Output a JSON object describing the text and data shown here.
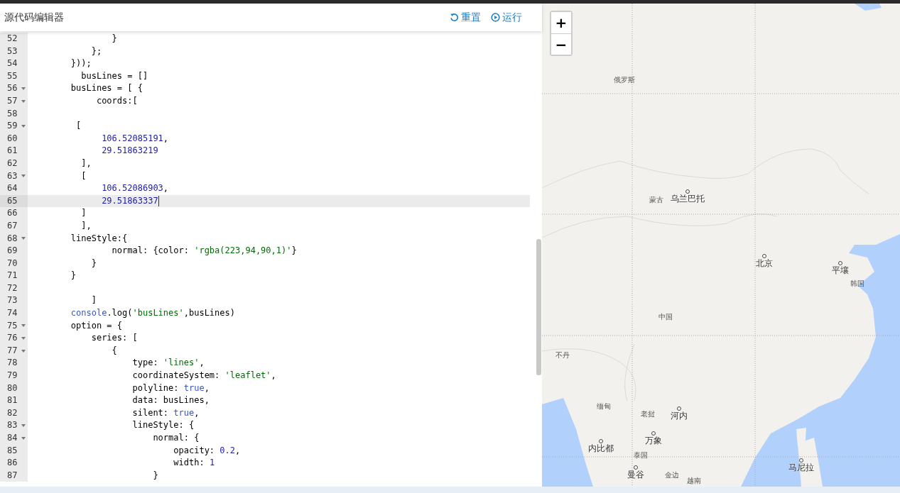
{
  "editor": {
    "title": "源代码编辑器",
    "actions": [
      {
        "kind": "reset",
        "label": "重置"
      },
      {
        "kind": "run",
        "label": "运行"
      }
    ],
    "lines": [
      {
        "number": "52",
        "fold": false,
        "current": false,
        "tokens": [
          {
            "kind": "plain",
            "text": "                }"
          }
        ]
      },
      {
        "number": "53",
        "fold": false,
        "current": false,
        "tokens": [
          {
            "kind": "plain",
            "text": "            };"
          }
        ]
      },
      {
        "number": "54",
        "fold": false,
        "current": false,
        "tokens": [
          {
            "kind": "plain",
            "text": "        }));"
          }
        ]
      },
      {
        "number": "55",
        "fold": false,
        "current": false,
        "tokens": [
          {
            "kind": "plain",
            "text": "          busLines = []"
          }
        ]
      },
      {
        "number": "56",
        "fold": true,
        "current": false,
        "tokens": [
          {
            "kind": "plain",
            "text": "        busLines = [ {"
          }
        ]
      },
      {
        "number": "57",
        "fold": true,
        "current": false,
        "tokens": [
          {
            "kind": "plain",
            "text": "             coords:["
          }
        ]
      },
      {
        "number": "58",
        "fold": false,
        "current": false
      },
      {
        "number": "59",
        "fold": true,
        "current": false,
        "tokens": [
          {
            "kind": "plain",
            "text": "         ["
          }
        ]
      },
      {
        "number": "60",
        "fold": false,
        "current": false,
        "tokens": [
          {
            "kind": "number",
            "text": "              106.52085191"
          },
          {
            "kind": "plain",
            "text": ","
          }
        ]
      },
      {
        "number": "61",
        "fold": false,
        "current": false,
        "tokens": [
          {
            "kind": "number",
            "text": "              29.51863219"
          }
        ]
      },
      {
        "number": "62",
        "fold": false,
        "current": false,
        "tokens": [
          {
            "kind": "plain",
            "text": "          ],"
          }
        ]
      },
      {
        "number": "63",
        "fold": true,
        "current": false,
        "tokens": [
          {
            "kind": "plain",
            "text": "          ["
          }
        ]
      },
      {
        "number": "64",
        "fold": false,
        "current": false,
        "tokens": [
          {
            "kind": "number",
            "text": "              106.52086903"
          },
          {
            "kind": "plain",
            "text": ","
          }
        ]
      },
      {
        "number": "65",
        "fold": false,
        "current": true,
        "tokens": [
          {
            "kind": "number",
            "text": "              29.51863337"
          }
        ]
      },
      {
        "number": "66",
        "fold": false,
        "current": false,
        "tokens": [
          {
            "kind": "plain",
            "text": "          ]"
          }
        ]
      },
      {
        "number": "67",
        "fold": false,
        "current": false,
        "tokens": [
          {
            "kind": "plain",
            "text": "          ],"
          }
        ]
      },
      {
        "number": "68",
        "fold": true,
        "current": false,
        "tokens": [
          {
            "kind": "plain",
            "text": "        lineStyle:{"
          }
        ]
      },
      {
        "number": "69",
        "fold": false,
        "current": false,
        "tokens": [
          {
            "kind": "plain",
            "text": "                normal: {color: "
          },
          {
            "kind": "string",
            "text": "'rgba(223,94,90,1)'"
          },
          {
            "kind": "plain",
            "text": "}"
          }
        ]
      },
      {
        "number": "70",
        "fold": false,
        "current": false,
        "tokens": [
          {
            "kind": "plain",
            "text": "            }"
          }
        ]
      },
      {
        "number": "71",
        "fold": false,
        "current": false,
        "tokens": [
          {
            "kind": "plain",
            "text": "        }"
          }
        ]
      },
      {
        "number": "72",
        "fold": false,
        "current": false
      },
      {
        "number": "73",
        "fold": false,
        "current": false,
        "tokens": [
          {
            "kind": "plain",
            "text": "            ]"
          }
        ]
      },
      {
        "number": "74",
        "fold": false,
        "current": false,
        "tokens": [
          {
            "kind": "keyword",
            "text": "        console"
          },
          {
            "kind": "plain",
            "text": ".log("
          },
          {
            "kind": "string",
            "text": "'busLines'"
          },
          {
            "kind": "plain",
            "text": ",busLines)"
          }
        ]
      },
      {
        "number": "75",
        "fold": true,
        "current": false,
        "tokens": [
          {
            "kind": "plain",
            "text": "        option = {"
          }
        ]
      },
      {
        "number": "76",
        "fold": true,
        "current": false,
        "tokens": [
          {
            "kind": "plain",
            "text": "            series: ["
          }
        ]
      },
      {
        "number": "77",
        "fold": true,
        "current": false,
        "tokens": [
          {
            "kind": "plain",
            "text": "                {"
          }
        ]
      },
      {
        "number": "78",
        "fold": false,
        "current": false,
        "tokens": [
          {
            "kind": "plain",
            "text": "                    type: "
          },
          {
            "kind": "string",
            "text": "'lines'"
          },
          {
            "kind": "plain",
            "text": ","
          }
        ]
      },
      {
        "number": "79",
        "fold": false,
        "current": false,
        "tokens": [
          {
            "kind": "plain",
            "text": "                    coordinateSystem: "
          },
          {
            "kind": "string",
            "text": "'leaflet'"
          },
          {
            "kind": "plain",
            "text": ","
          }
        ]
      },
      {
        "number": "80",
        "fold": false,
        "current": false,
        "tokens": [
          {
            "kind": "plain",
            "text": "                    polyline: "
          },
          {
            "kind": "keyword",
            "text": "true"
          },
          {
            "kind": "plain",
            "text": ","
          }
        ]
      },
      {
        "number": "81",
        "fold": false,
        "current": false,
        "tokens": [
          {
            "kind": "plain",
            "text": "                    data: busLines,"
          }
        ]
      },
      {
        "number": "82",
        "fold": false,
        "current": false,
        "tokens": [
          {
            "kind": "plain",
            "text": "                    silent: "
          },
          {
            "kind": "keyword",
            "text": "true"
          },
          {
            "kind": "plain",
            "text": ","
          }
        ]
      },
      {
        "number": "83",
        "fold": true,
        "current": false,
        "tokens": [
          {
            "kind": "plain",
            "text": "                    lineStyle: {"
          }
        ]
      },
      {
        "number": "84",
        "fold": true,
        "current": false,
        "tokens": [
          {
            "kind": "plain",
            "text": "                        normal: {"
          }
        ]
      },
      {
        "number": "85",
        "fold": false,
        "current": false,
        "tokens": [
          {
            "kind": "plain",
            "text": "                            opacity: "
          },
          {
            "kind": "number",
            "text": "0.2"
          },
          {
            "kind": "plain",
            "text": ","
          }
        ]
      },
      {
        "number": "86",
        "fold": false,
        "current": false,
        "tokens": [
          {
            "kind": "plain",
            "text": "                            width: "
          },
          {
            "kind": "number",
            "text": "1"
          }
        ]
      },
      {
        "number": "87",
        "fold": false,
        "current": false,
        "tokens": [
          {
            "kind": "plain",
            "text": "                        }"
          }
        ]
      }
    ]
  },
  "map": {
    "zoom": [
      "+",
      "−"
    ],
    "labels": [
      {
        "text": "俄罗斯",
        "kind": "country"
      },
      {
        "text": "蒙古",
        "kind": "country"
      },
      {
        "text": "乌兰巴托",
        "kind": "city"
      },
      {
        "text": "北京",
        "kind": "city"
      },
      {
        "text": "平壤",
        "kind": "city"
      },
      {
        "text": "韩国",
        "kind": "country"
      },
      {
        "text": "中国",
        "kind": "country"
      },
      {
        "text": "不丹",
        "kind": "country"
      },
      {
        "text": "缅甸",
        "kind": "country"
      },
      {
        "text": "老挝",
        "kind": "country"
      },
      {
        "text": "河内",
        "kind": "city"
      },
      {
        "text": "万象",
        "kind": "city"
      },
      {
        "text": "内比都",
        "kind": "city"
      },
      {
        "text": "泰国",
        "kind": "country"
      },
      {
        "text": "曼谷",
        "kind": "city"
      },
      {
        "text": "金边",
        "kind": "country"
      },
      {
        "text": "越南",
        "kind": "country"
      },
      {
        "text": "马尼拉",
        "kind": "city"
      }
    ]
  }
}
